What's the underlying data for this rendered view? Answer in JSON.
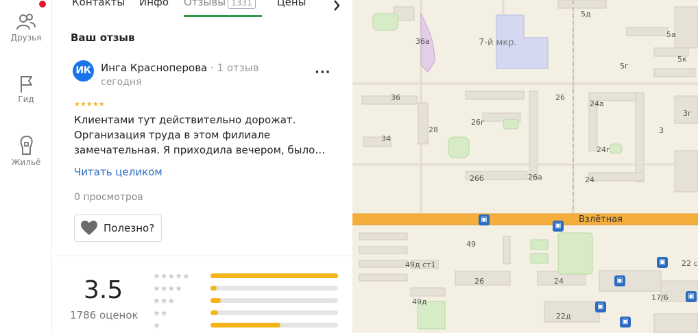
{
  "nav": {
    "items": [
      {
        "label": "Друзья",
        "icon": "friends-icon"
      },
      {
        "label": "Гид",
        "icon": "flag-icon"
      },
      {
        "label": "Жильё",
        "icon": "house-icon"
      }
    ]
  },
  "tabs": {
    "items": [
      "Контакты",
      "Инфо",
      "Отзывы",
      "Цены"
    ],
    "reviews_count": "1331",
    "active": "Отзывы"
  },
  "review": {
    "section_title": "Ваш отзыв",
    "avatar_initials": "ИК",
    "author": "Инга Красноперова",
    "author_meta": " · 1 отзыв",
    "date": "сегодня",
    "more": "···",
    "stars": 5,
    "stars_text": "★★★★★",
    "text": "Клиентами тут действительно дорожат. Организация труда в этом филиале замечательная. Я приходила вечером, было…",
    "read_more": "Читать целиком",
    "views": "0 просмотров",
    "useful_label": "Полезно?"
  },
  "summary": {
    "rating": "3.5",
    "count": "1786 оценок",
    "distribution": [
      {
        "stars": "★★★★★",
        "fraction": 1.0
      },
      {
        "stars": "★★★★",
        "fraction": 0.05
      },
      {
        "stars": "★★★",
        "fraction": 0.08
      },
      {
        "stars": "★★",
        "fraction": 0.06
      },
      {
        "stars": "★",
        "fraction": 0.55
      }
    ]
  },
  "map": {
    "labels": [
      "36а",
      "7-й мкр.",
      "5д",
      "5а",
      "5к",
      "5г",
      "36",
      "28",
      "34",
      "26г",
      "26",
      "24а",
      "24г",
      "3г",
      "3",
      "26б",
      "26а",
      "24",
      "Взлётная",
      "49",
      "49д ст1",
      "26",
      "24",
      "22 с",
      "17/6",
      "49д",
      "22д"
    ]
  },
  "colors": {
    "accent_green": "#2c9a4a",
    "link_blue": "#2b6cc2",
    "star_yellow": "#f5b419",
    "avatar_blue": "#1a73e8",
    "road_orange": "#f5ae3c"
  }
}
